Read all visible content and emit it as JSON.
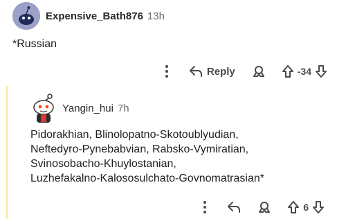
{
  "comments": [
    {
      "username": "Expensive_Bath876",
      "time": "13h",
      "body": "*Russian",
      "reply_label": "Reply",
      "score": "-34",
      "avatar_icon": "snoo-avatar-icon"
    },
    {
      "username": "Yangin_hui",
      "time": "7h",
      "body_lines": [
        "Pidorakhian, Blinolopatno-Skotoublyudian,",
        "Neftedyro-Pynebabvian, Rabsko-Vymiratian,",
        "Svinosobacho-Khuylostanian,",
        "Luzhefakalno-Kalososulchato-Govnomatrasian*"
      ],
      "score": "6",
      "avatar_icon": "snoo-avatar-icon"
    }
  ],
  "colors": {
    "thread_line": "#f5e7a3",
    "text": "#1c1c1c",
    "muted": "#6b6b6b",
    "icon": "#4a4a4a"
  }
}
